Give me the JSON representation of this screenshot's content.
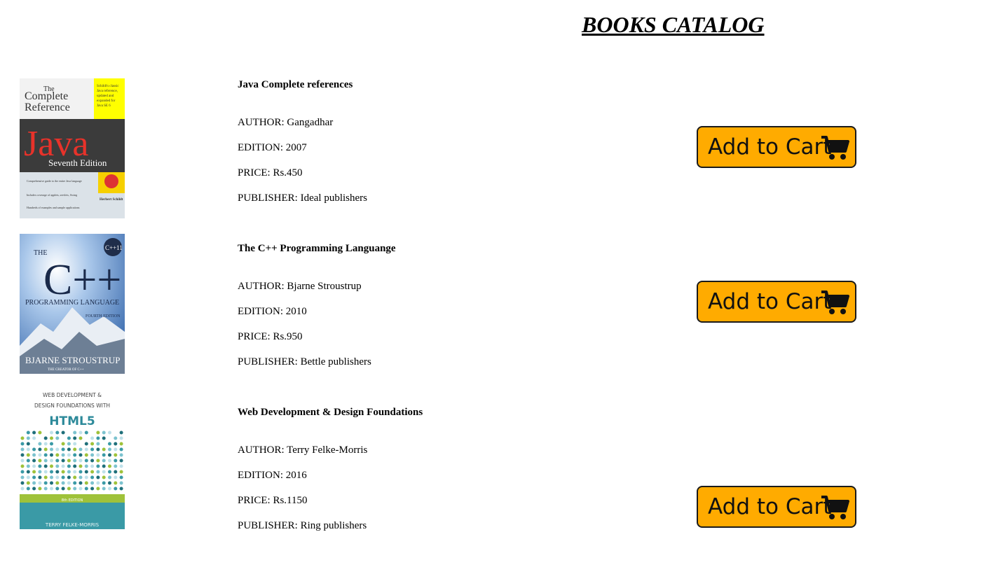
{
  "page": {
    "title": "BOOKS CATALOG"
  },
  "labels": {
    "author": "AUTHOR: ",
    "edition": "EDITION: ",
    "price": "PRICE: ",
    "publisher": "PUBLISHER: "
  },
  "cart_button": {
    "label": "Add to Cart",
    "icon": "shopping-cart-icon",
    "color": "#ffab00"
  },
  "books": [
    {
      "title": "Java Complete references",
      "author": "Gangadhar",
      "edition": "2007",
      "price": "Rs.450",
      "publisher": "Ideal publishers",
      "cover": {
        "line1": "The",
        "line2": "Complete",
        "line3": "Reference",
        "big": "Java",
        "subtitle": "Seventh Edition",
        "badge": "Schildt's classic Java reference, updated and expanded for Java SE 6",
        "author": "Herbert Schildt"
      }
    },
    {
      "title": "The C++ Programming Languange",
      "author": "Bjarne Stroustrup",
      "edition": "2010",
      "price": "Rs.950",
      "publisher": "Bettle publishers",
      "cover": {
        "the": "THE",
        "big": "C++",
        "badge": "C++11",
        "line": "PROGRAMMING LANGUAGE",
        "edition": "FOURTH EDITION",
        "author": "BJARNE STROUSTRUP",
        "tag": "THE CREATOR OF C++"
      }
    },
    {
      "title": "Web Development & Design Foundations",
      "author": "Terry Felke-Morris",
      "edition": "2016",
      "price": "Rs.1150",
      "publisher": "Ring publishers",
      "cover": {
        "line1": "WEB DEVELOPMENT &",
        "line2": "DESIGN FOUNDATIONS WITH",
        "big": "HTML5",
        "edition": "8th EDITION",
        "author": "TERRY FELKE-MORRIS"
      }
    }
  ]
}
